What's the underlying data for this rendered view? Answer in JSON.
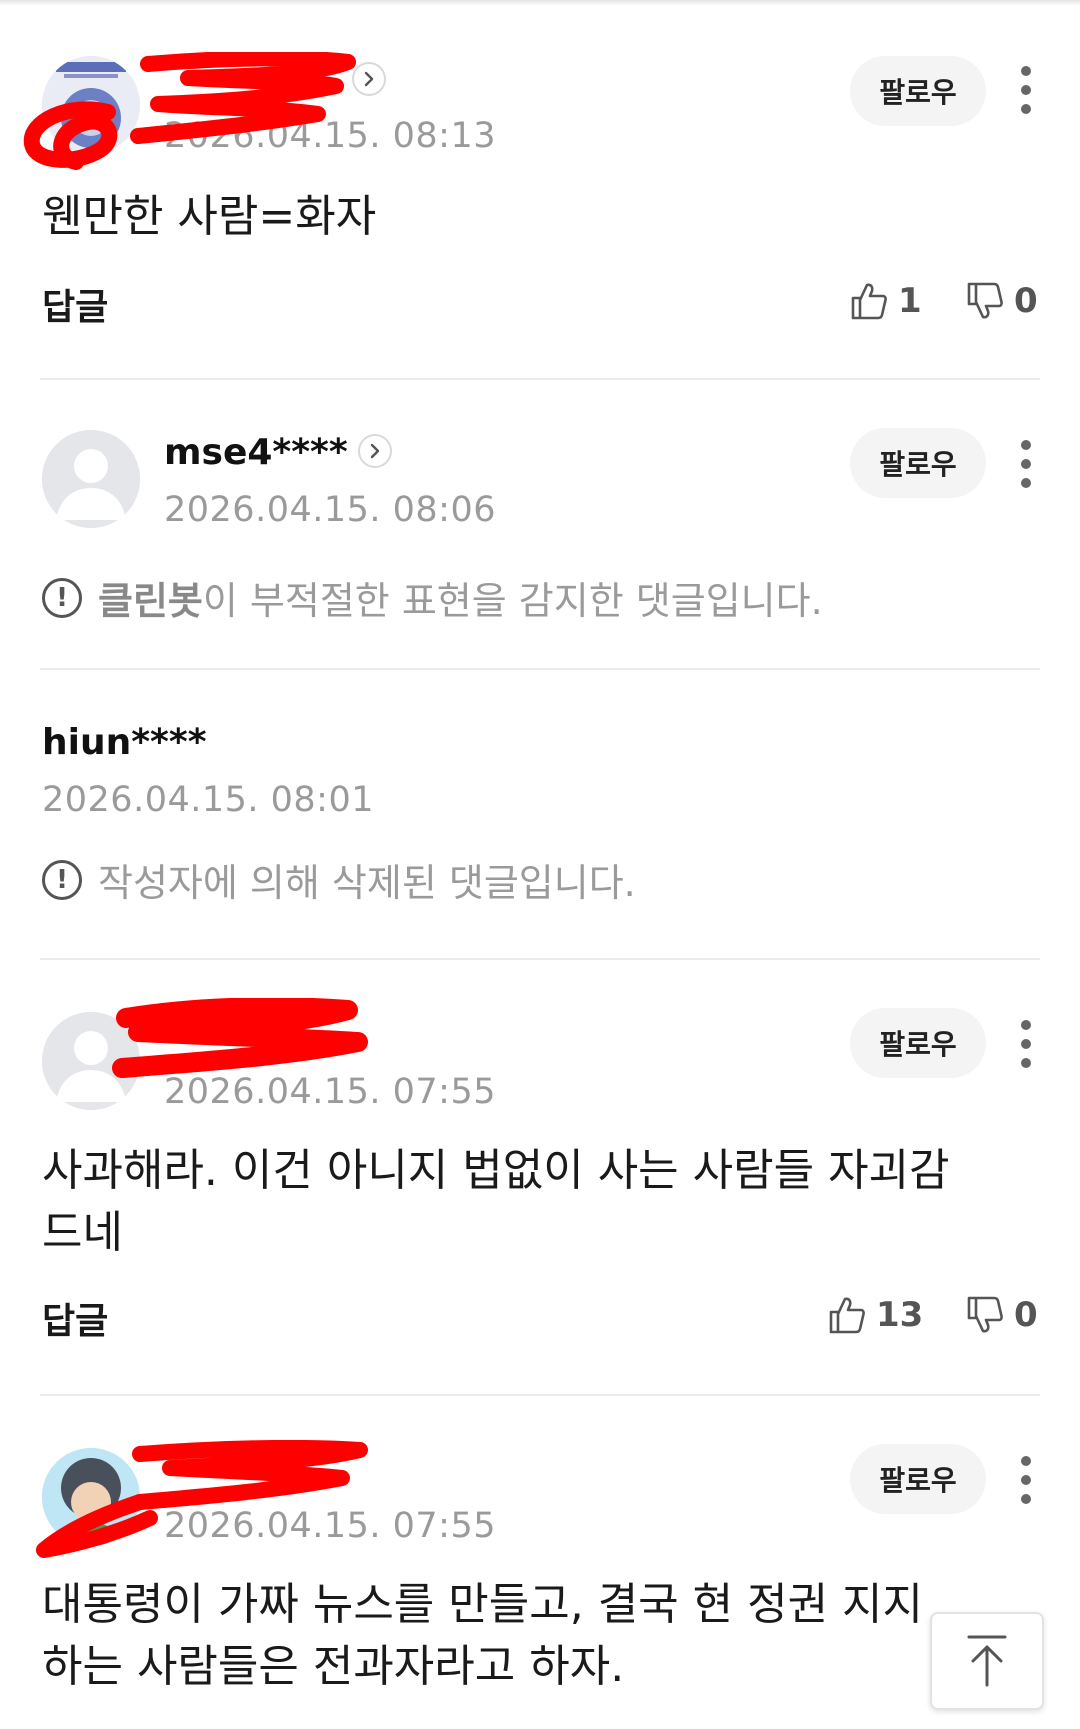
{
  "follow_label": "팔로우",
  "reply_label": "답글",
  "comments": [
    {
      "username": "",
      "timestamp": "2026.04.15. 08:13",
      "text": "웬만한 사람=화자",
      "likes": "1",
      "dislikes": "0",
      "username_redacted": true
    },
    {
      "username": "mse4****",
      "timestamp": "2026.04.15. 08:06",
      "notice_strong": "클린봇",
      "notice_rest": "이 부적절한 표현을 감지한 댓글입니다."
    },
    {
      "username": "hiun****",
      "timestamp": "2026.04.15. 08:01",
      "notice_text": "작성자에 의해 삭제된 댓글입니다."
    },
    {
      "username": "",
      "timestamp": "2026.04.15. 07:55",
      "text": "사과해라. 이건 아니지 법없이 사는 사람들 자괴감드네",
      "likes": "13",
      "dislikes": "0",
      "username_redacted": true
    },
    {
      "username": "",
      "timestamp": "2026.04.15. 07:55",
      "text": "대통령이 가짜 뉴스를 만들고, 결국 현 정권 지지하는 사람들은 전과자라고 하자.",
      "username_redacted": true
    }
  ],
  "icons": {
    "like": "thumbs-up-icon",
    "dislike": "thumbs-down-icon",
    "more": "vertical-ellipsis-icon",
    "chevron": "chevron-right-icon",
    "notice": "exclamation-circle-icon",
    "scroll_top": "arrow-up-icon"
  },
  "colors": {
    "redaction": "#ff0000",
    "timestamp": "#9a9a9a",
    "follow_bg": "#f4f4f4"
  }
}
